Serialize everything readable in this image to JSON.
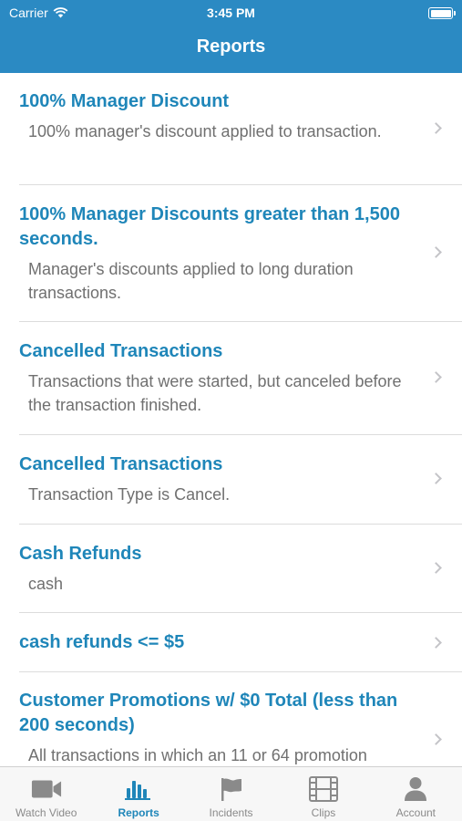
{
  "status_bar": {
    "carrier": "Carrier",
    "time": "3:45 PM"
  },
  "nav": {
    "title": "Reports"
  },
  "reports": [
    {
      "title": "100% Manager Discount",
      "description": "100% manager's discount applied to transaction."
    },
    {
      "title": "100% Manager Discounts greater than 1,500 seconds.",
      "description": "Manager's discounts applied to long duration transactions."
    },
    {
      "title": "Cancelled Transactions",
      "description": "Transactions that were started, but canceled before the transaction finished."
    },
    {
      "title": "Cancelled Transactions",
      "description": "Transaction Type is Cancel."
    },
    {
      "title": "Cash Refunds",
      "description": "cash"
    },
    {
      "title": "cash refunds <= $5",
      "description": ""
    },
    {
      "title": "Customer Promotions w/ $0 Total (less than 200 seconds)",
      "description": "All transactions in which an 11 or 64 promotion"
    }
  ],
  "tabs": [
    {
      "label": "Watch Video",
      "icon": "video-camera-icon",
      "active": false
    },
    {
      "label": "Reports",
      "icon": "bar-chart-icon",
      "active": true
    },
    {
      "label": "Incidents",
      "icon": "flag-icon",
      "active": false
    },
    {
      "label": "Clips",
      "icon": "film-strip-icon",
      "active": false
    },
    {
      "label": "Account",
      "icon": "person-icon",
      "active": false
    }
  ],
  "colors": {
    "header": "#2b8ac3",
    "accent": "#1f86b9",
    "inactive": "#8a8a8a"
  }
}
